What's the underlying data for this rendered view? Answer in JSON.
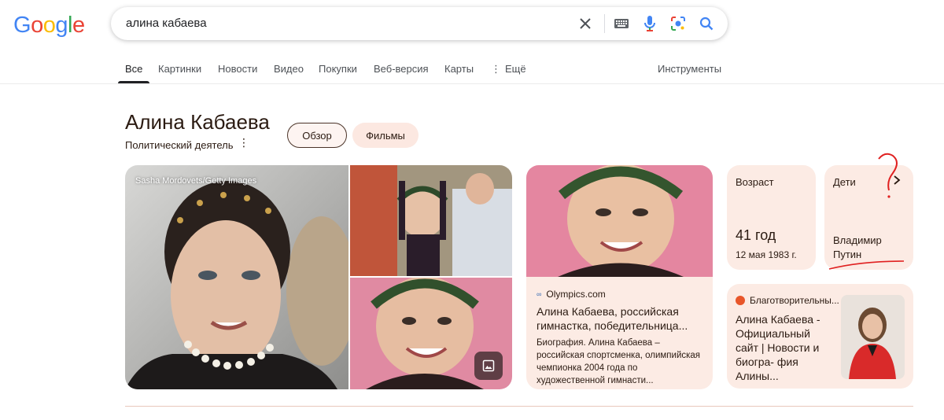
{
  "logo": {
    "letters": [
      "G",
      "o",
      "o",
      "g",
      "l",
      "e"
    ],
    "colors": [
      "#4285F4",
      "#EA4335",
      "#FBBC05",
      "#4285F4",
      "#34A853",
      "#EA4335"
    ]
  },
  "search": {
    "query": "алина кабаева"
  },
  "tabs": [
    {
      "label": "Все",
      "active": true
    },
    {
      "label": "Картинки"
    },
    {
      "label": "Новости"
    },
    {
      "label": "Видео"
    },
    {
      "label": "Покупки"
    },
    {
      "label": "Веб-версия"
    },
    {
      "label": "Карты"
    },
    {
      "label": "Ещё"
    }
  ],
  "tools_label": "Инструменты",
  "entity": {
    "title": "Алина Кабаева",
    "subtitle": "Политический деятель",
    "chips": [
      "Обзор",
      "Фильмы"
    ]
  },
  "photos": {
    "credit": "Sasha Mordovets/Getty Images"
  },
  "article": {
    "source": "Olympics.com",
    "title": "Алина Кабаева, российская гимнастка, победительница...",
    "snippet": "Биография. Алина Кабаева – российская спортсменка, олимпийская чемпионка 2004 года по художественной гимнасти..."
  },
  "facts": {
    "age_label": "Возраст",
    "age_value": "41 год",
    "birth_date": "12 мая 1983 г.",
    "children_label": "Дети",
    "children_line1": "Владимир",
    "children_line2": "Путин"
  },
  "site": {
    "source": "Благотворительны...",
    "title": "Алина Кабаева - Официальный сайт | Новости и биогра- фия Алины..."
  },
  "colors": {
    "card_bg": "#fcebe4",
    "annotation": "#e02020"
  }
}
